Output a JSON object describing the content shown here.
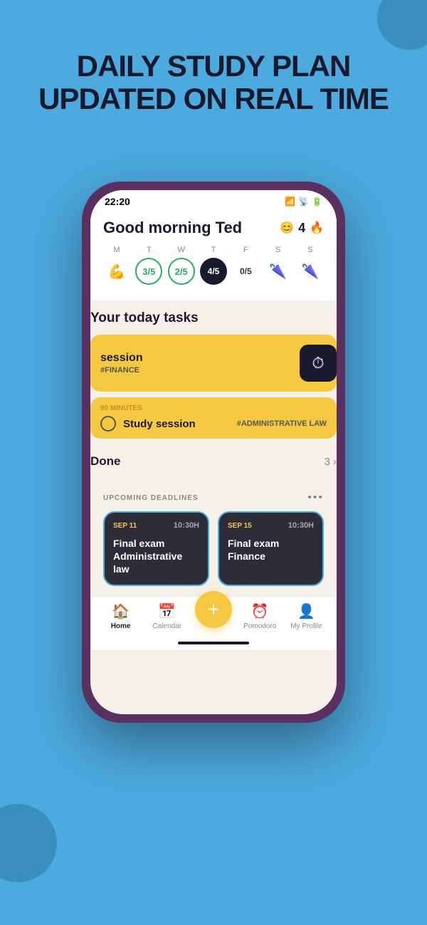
{
  "header": {
    "line1": "DAILY STUDY PLAN",
    "line2": "UPDATED ON REAL TIME"
  },
  "status_bar": {
    "time": "22:20",
    "icons": "▲▲▲ ◀ ▮▮"
  },
  "greeting": {
    "text": "Good morning Ted",
    "emoji": "😊",
    "streak": "4",
    "fire": "🔥"
  },
  "week": {
    "days": [
      "M",
      "T",
      "W",
      "T",
      "F",
      "S",
      "S"
    ],
    "items": [
      {
        "label": "💪",
        "type": "emoji"
      },
      {
        "label": "3/5",
        "type": "fraction"
      },
      {
        "label": "2/5",
        "type": "fraction"
      },
      {
        "label": "4/5",
        "type": "today"
      },
      {
        "label": "0/5",
        "type": "fraction"
      },
      {
        "label": "🌂",
        "type": "emoji"
      },
      {
        "label": "🌂",
        "type": "emoji"
      }
    ]
  },
  "today_tasks": {
    "section_title": "Your today tasks",
    "tasks": [
      {
        "title": "session",
        "tag": "#FINANCE",
        "type": "active"
      },
      {
        "minutes": "90 MINUTES",
        "title": "Study session",
        "tag": "#ADMINISTRATIVE LAW",
        "type": "pending"
      }
    ],
    "done_label": "Done",
    "done_count": "3"
  },
  "upcoming": {
    "title": "UPCOMING DEADLINES",
    "deadlines": [
      {
        "date": "SEP 11",
        "time": "10:30H",
        "title": "Final exam Administrative law"
      },
      {
        "date": "SEP 15",
        "time": "10:30H",
        "title": "Final exam Finance"
      }
    ]
  },
  "nav": {
    "items": [
      {
        "label": "Home",
        "icon": "🏠",
        "active": true
      },
      {
        "label": "Calendar",
        "icon": "📅",
        "active": false
      },
      {
        "label": "+",
        "icon": "+",
        "active": false,
        "fab": true
      },
      {
        "label": "Pomodoro",
        "icon": "⏰",
        "active": false
      },
      {
        "label": "My Profile",
        "icon": "👤",
        "active": false
      }
    ]
  }
}
